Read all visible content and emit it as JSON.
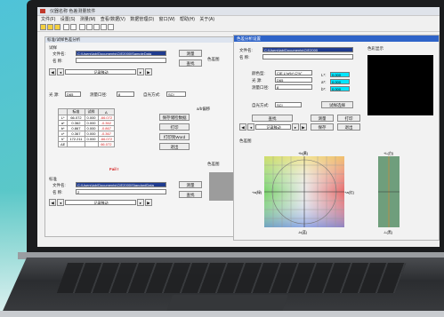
{
  "app": {
    "title": "仪器名称  色差测量软件",
    "menu": [
      "文件(F)",
      "设置(S)",
      "测量(M)",
      "查看/数据(V)",
      "数据管理(D)",
      "窗口(W)",
      "帮助(H)",
      "关于(A)"
    ],
    "subwindow_title": "标准/试样色差分析"
  },
  "sample_panel": {
    "group_label": "试样",
    "file_label": "文件名:",
    "file_value": "C:\\Users\\lab\\Documents\\CIE2000\\SampleData",
    "name_label": "名  称:",
    "measure_btn": "测量",
    "query_btn": "查找",
    "nav_label": "记录移动",
    "light_label": "光  源:",
    "light_value": "D65",
    "observer_label": "测量口径:",
    "observer_value": "8",
    "ratio_label": "自光方式:",
    "ratio_value": "SCI"
  },
  "data_table": {
    "headers": [
      "",
      "标准",
      "试样",
      "Δ"
    ],
    "rows": [
      [
        "L*",
        "66.072",
        "0.000",
        "-66.072"
      ],
      [
        "a*",
        "0.362",
        "0.000",
        "-0.362"
      ],
      [
        "b*",
        "0.867",
        "0.000",
        "-0.867"
      ],
      [
        "c*",
        "0.367",
        "0.000",
        "-0.367"
      ],
      [
        "h°",
        "172.211",
        "0.000",
        "-66.072"
      ],
      [
        "ΔE",
        "",
        "",
        "66.072"
      ]
    ],
    "fail_text": "Fail !"
  },
  "side_buttons": [
    "保存储检数据",
    "打印",
    "打印到Word",
    "退出"
  ],
  "standard_panel": {
    "group_label": "标准",
    "file_label": "文件名:",
    "file_value": "C:\\Users\\lab\\Documents\\CIE2000\\StandardData",
    "name_label": "名  称:",
    "name_value": "2",
    "measure_btn": "测量",
    "query_btn": "查找",
    "nav_label": "记录移动"
  },
  "color_diagram_label": "色差图",
  "color_display_label": "色差图",
  "ab_label": "a/b偏移",
  "fg_window": {
    "title": "色差分析设置",
    "file_label": "文件名:",
    "file_value": "C:\\Users\\lab\\Documents\\CIE2000",
    "name_label": "名  称:",
    "model_label": "颜色型:",
    "model_value": "CIE L*a*b* C*h°",
    "light_label": "光  源:",
    "light_value": "D65",
    "aperture_label": "测量口径:",
    "aperture_value": "8",
    "lightmode_label": "自光方式:",
    "lightmode_value": "SCI",
    "kl_label": "L*:",
    "kl_value": "0.000",
    "ka_label": "a*:",
    "ka_value": "0.000",
    "kb_label": "b*:",
    "kb_value": "0.000",
    "chart_btn": "试样选择",
    "save_btn": "查找",
    "measure_btn": "测量",
    "print_btn": "打印",
    "nav_label": "记录移动",
    "prev_btn": "保存",
    "exit_btn": "退出",
    "color_display_label": "色彩显示",
    "diagram_label": "色差图",
    "axis_top": "+b(黄)",
    "axis_bottom": "-b(蓝)",
    "axis_left": "+a(绿)",
    "axis_right": "+a(红)",
    "lbar_top": "+L(白)",
    "lbar_bottom": "-L(黑)"
  },
  "colors": {
    "selected": "#1f3b8f",
    "cyan": "#00e5ff",
    "fail": "#d31c1c"
  }
}
